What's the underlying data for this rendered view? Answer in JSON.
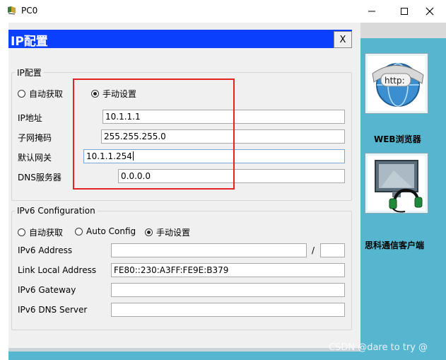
{
  "window": {
    "title": "PC0"
  },
  "dialog": {
    "title": "IP配置",
    "close_label": "X"
  },
  "ipv4": {
    "legend": "IP配置",
    "radio_auto": "自动获取",
    "radio_manual": "手动设置",
    "selected": "manual",
    "ip_label": "IP地址",
    "ip_value": "10.1.1.1",
    "mask_label": "子网掩码",
    "mask_value": "255.255.255.0",
    "gateway_label": "默认网关",
    "gateway_value": "10.1.1.254",
    "dns_label": "DNS服务器",
    "dns_value": "0.0.0.0"
  },
  "ipv6": {
    "legend": "IPv6 Configuration",
    "radio_auto": "自动获取",
    "radio_autoconfig": "Auto Config",
    "radio_manual": "手动设置",
    "selected": "manual",
    "address_label": "IPv6 Address",
    "address_value": "",
    "prefix_separator": "/",
    "prefix_value": "",
    "link_local_label": "Link Local Address",
    "link_local_value": "FE80::230:A3FF:FE9E:B379",
    "gateway_label": "IPv6 Gateway",
    "gateway_value": "",
    "dns_label": "IPv6 DNS Server",
    "dns_value": ""
  },
  "apps": [
    {
      "label": "WEB浏览器",
      "icon": "http-globe-icon"
    },
    {
      "label": "思科通信客户端",
      "icon": "monitor-headset-icon"
    }
  ],
  "watermark": "CSDN @dare to try @",
  "colors": {
    "dialog_title_bar": "#0a3ffb",
    "side_panel": "#56b6cf",
    "highlight_box": "#e32222"
  }
}
